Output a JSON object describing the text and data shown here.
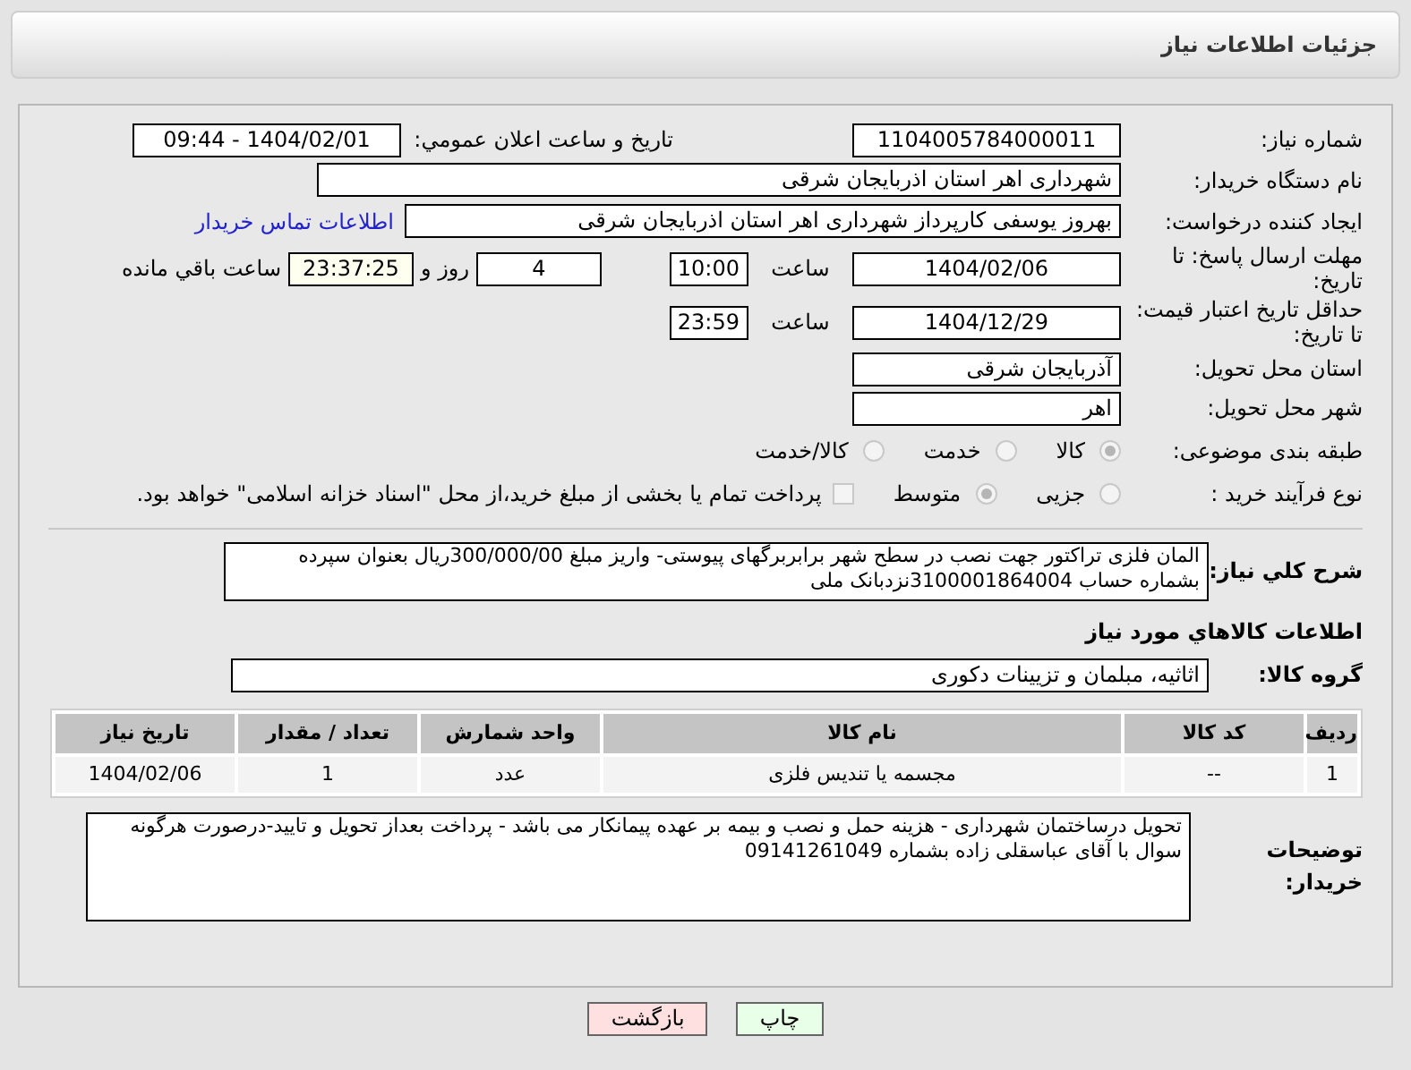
{
  "page": {
    "title": "جزئیات اطلاعات نیاز"
  },
  "need_number": {
    "label": "شماره نیاز:",
    "value": "1104005784000011"
  },
  "announce": {
    "label": "تاريخ و ساعت اعلان عمومي:",
    "value": "1404/02/01 - 09:44"
  },
  "buyer_org": {
    "label": "نام دستگاه خریدار:",
    "value": "شهرداری اهر استان اذربایجان شرقی"
  },
  "requester": {
    "label": "ایجاد کننده درخواست:",
    "value": "بهروز یوسفی کارپرداز شهرداری اهر استان اذربایجان شرقی",
    "link": "اطلاعات تماس خریدار"
  },
  "deadline": {
    "label": "مهلت ارسال پاسخ: تا تاریخ:",
    "date": "1404/02/06",
    "time_label": "ساعت",
    "time": "10:00",
    "days": "4",
    "days_suffix": "روز و",
    "remaining": "23:37:25",
    "remaining_suffix": "ساعت باقي مانده"
  },
  "validity": {
    "label": "حداقل تاريخ اعتبار قيمت: تا تاريخ:",
    "date": "1404/12/29",
    "time_label": "ساعت",
    "time": "23:59"
  },
  "province": {
    "label": "استان محل تحویل:",
    "value": "آذربایجان شرقی"
  },
  "city": {
    "label": "شهر محل تحویل:",
    "value": "اهر"
  },
  "category": {
    "label": "طبقه بندی موضوعی:",
    "options": [
      {
        "label": "کالا",
        "selected": true
      },
      {
        "label": "خدمت",
        "selected": false
      },
      {
        "label": "کالا/خدمت",
        "selected": false
      }
    ]
  },
  "process": {
    "label": "نوع فرآیند خرید :",
    "options": [
      {
        "label": "جزیی",
        "selected": false
      },
      {
        "label": "متوسط",
        "selected": true
      }
    ],
    "payment": {
      "label": "پرداخت تمام یا بخشی از مبلغ خرید،از محل \"اسناد خزانه اسلامی\" خواهد بود.",
      "checked": false
    }
  },
  "description": {
    "label": "شرح کلي نياز:",
    "value": "المان فلزی تراکتور جهت نصب در سطح شهر برابربرگهای پیوستی- واریز مبلغ 300/000/00ریال بعنوان سپرده بشماره حساب 3100001864004نزدبانک ملی"
  },
  "goods_heading": "اطلاعات کالاهاي مورد نياز",
  "goods_group": {
    "label": "گروه کالا:",
    "value": "اثاثیه، مبلمان و تزیینات دکوری"
  },
  "table": {
    "columns": [
      "ردیف",
      "کد کالا",
      "نام کالا",
      "واحد شمارش",
      "تعداد / مقدار",
      "تاریخ نیاز"
    ],
    "rows": [
      [
        "1",
        "--",
        "مجسمه یا تندیس فلزی",
        "عدد",
        "1",
        "1404/02/06"
      ]
    ]
  },
  "buyer_notes": {
    "label": "توضیحات خریدار:",
    "value": "تحویل درساختمان شهرداری - هزینه حمل و نصب و بیمه بر عهده پیمانکار می باشد - پرداخت بعداز تحویل و تایید-درصورت هرگونه سوال با آقای عباسقلی زاده بشماره 09141261049"
  },
  "buttons": [
    {
      "label": "چاپ",
      "kind": "print"
    },
    {
      "label": "بازگشت",
      "kind": "back"
    }
  ]
}
